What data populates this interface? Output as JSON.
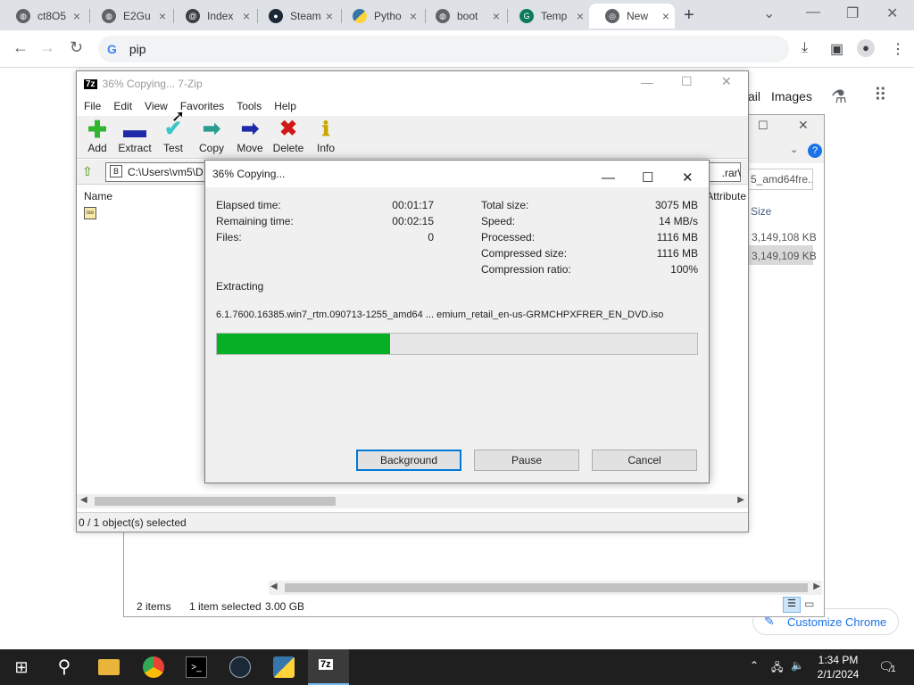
{
  "browser": {
    "tabs": [
      {
        "title": "ct8O5",
        "favicon": "globe-icon"
      },
      {
        "title": "E2Gu",
        "favicon": "globe-icon"
      },
      {
        "title": "Index",
        "favicon": "pypi-icon"
      },
      {
        "title": "Steam",
        "favicon": "steam-icon"
      },
      {
        "title": "Pytho",
        "favicon": "python-icon"
      },
      {
        "title": "boot",
        "favicon": "globe-icon"
      },
      {
        "title": "Temp",
        "favicon": "temp-icon"
      },
      {
        "title": "New",
        "favicon": "chrome-icon"
      }
    ],
    "close_glyph": "×",
    "new_tab_glyph": "+",
    "address": "pip",
    "google_glyph": "G"
  },
  "google_page": {
    "mail_partial": "ail",
    "images_link": "Images",
    "customize_button": "Customize Chrome"
  },
  "explorer": {
    "partial_file": "5_amd64fre...",
    "size_header": "Size",
    "sizes": [
      "3,149,108 KB",
      "3,149,109 KB"
    ],
    "items_count": "2 items",
    "selection": "1 item selected",
    "selection_size": "3.00 GB"
  },
  "sevenzip": {
    "title": "36% Copying... 7-Zip",
    "logo": "7z",
    "menu": [
      "File",
      "Edit",
      "View",
      "Favorites",
      "Tools",
      "Help"
    ],
    "toolbar": [
      {
        "label": "Add",
        "icon": "plus-icon",
        "color": "#2fb52f"
      },
      {
        "label": "Extract",
        "icon": "minus-icon",
        "color": "#1e2aa8"
      },
      {
        "label": "Test",
        "icon": "check-icon",
        "color": "#39c6c6"
      },
      {
        "label": "Copy",
        "icon": "copy-arrow-icon",
        "color": "#2a9d8f"
      },
      {
        "label": "Move",
        "icon": "move-arrow-icon",
        "color": "#1e2aa8"
      },
      {
        "label": "Delete",
        "icon": "delete-x-icon",
        "color": "#d01818"
      },
      {
        "label": "Info",
        "icon": "info-icon",
        "color": "#c9a600"
      }
    ],
    "path": "C:\\Users\\vm5\\D",
    "path_end": ".rar\\",
    "column_name": "Name",
    "column_attributes": "Attribute",
    "status": "0 / 1 object(s) selected"
  },
  "dialog": {
    "title": "36% Copying...",
    "elapsed_label": "Elapsed time:",
    "elapsed_value": "00:01:17",
    "remaining_label": "Remaining time:",
    "remaining_value": "00:02:15",
    "files_label": "Files:",
    "files_value": "0",
    "total_label": "Total size:",
    "total_value": "3075 MB",
    "speed_label": "Speed:",
    "speed_value": "14 MB/s",
    "processed_label": "Processed:",
    "processed_value": "1116 MB",
    "compressed_label": "Compressed size:",
    "compressed_value": "1116 MB",
    "ratio_label": "Compression ratio:",
    "ratio_value": "100%",
    "operation": "Extracting",
    "file_path": "6.1.7600.16385.win7_rtm.090713-1255_amd64 ... emium_retail_en-us-GRMCHPXFRER_EN_DVD.iso",
    "progress_fraction": 0.36,
    "buttons": {
      "background": "Background",
      "pause": "Pause",
      "cancel": "Cancel"
    }
  },
  "taskbar": {
    "time": "1:34 PM",
    "date": "2/1/2024",
    "notification_count": "1",
    "active_app_label": "7z"
  }
}
